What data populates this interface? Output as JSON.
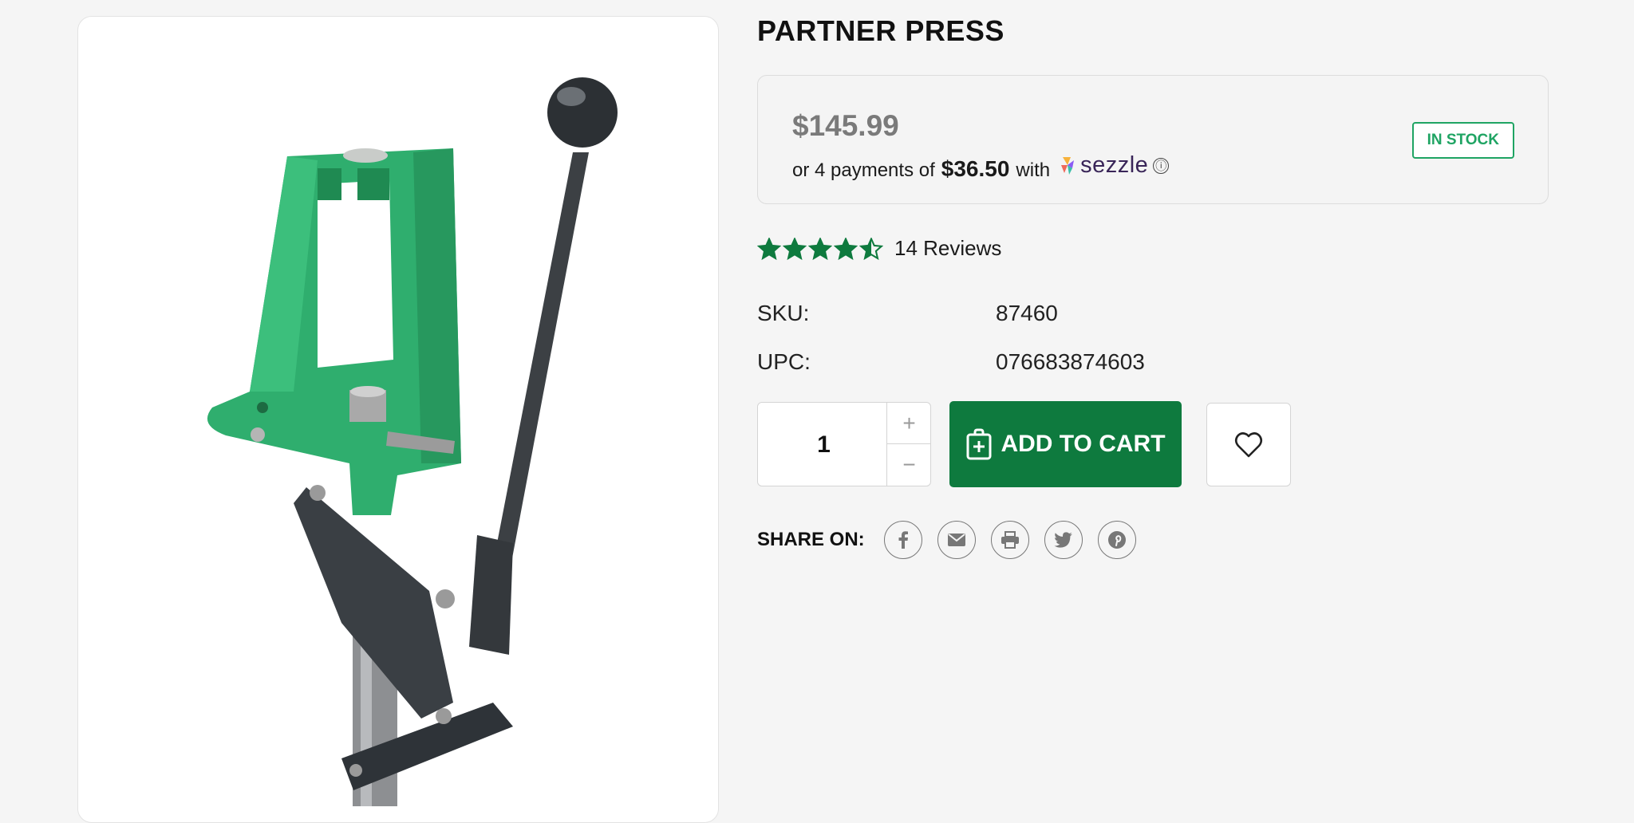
{
  "product": {
    "title": "PARTNER PRESS",
    "image_alt": "RCBS Partner Press reloading press"
  },
  "pricing": {
    "price": "$145.99",
    "installments_prefix": "or 4 payments of",
    "installment_amount": "$36.50",
    "installments_with": "with",
    "provider": "sezzle",
    "info_icon": "ⓘ",
    "stock_status": "IN STOCK"
  },
  "rating": {
    "stars": 4.5,
    "max_stars": 5,
    "reviews_label": "14 Reviews"
  },
  "specs": [
    {
      "label": "SKU:",
      "value": "87460"
    },
    {
      "label": "UPC:",
      "value": "076683874603"
    }
  ],
  "purchase": {
    "quantity": "1",
    "increment": "+",
    "decrement": "−",
    "add_to_cart": "ADD TO CART"
  },
  "share": {
    "label": "SHARE ON:",
    "icons": [
      "facebook-icon",
      "email-icon",
      "print-icon",
      "twitter-icon",
      "pinterest-icon"
    ]
  },
  "colors": {
    "brand_green": "#0e7a3e",
    "stock_green": "#1fa463",
    "price_gray": "#7a7a7a",
    "star_green": "#0e7a3e"
  }
}
